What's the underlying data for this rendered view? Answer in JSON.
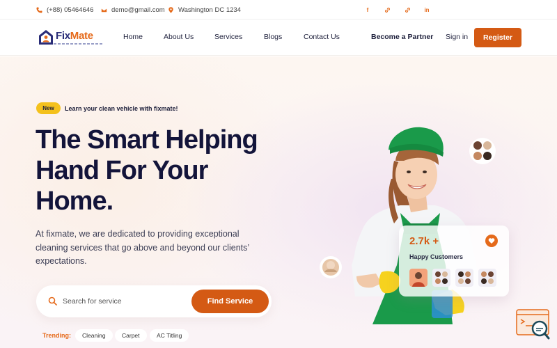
{
  "topbar": {
    "phone": "(+88) 05464646",
    "email": "demo@gmail.com",
    "address": "Washington DC 1234",
    "social": [
      "facebook-icon",
      "link-icon",
      "link-icon",
      "linkedin-icon"
    ],
    "linkedin_text": "in",
    "facebook_text": "f"
  },
  "nav": {
    "logo_fix": "Fix",
    "logo_mate": "Mate",
    "links": [
      "Home",
      "About Us",
      "Services",
      "Blogs",
      "Contact Us"
    ],
    "partner": "Become a Partner",
    "signin": "Sign in",
    "register": "Register"
  },
  "hero": {
    "badge": "New",
    "badge_text": "Learn your clean vehicle with fixmate!",
    "headline_lines": [
      "The Smart Helping",
      "Hand For Your",
      "Home."
    ],
    "lead": "At fixmate, we are dedicated to providing exceptional cleaning services that go above and beyond our clients’ expectations.",
    "search": {
      "placeholder": "Search for service",
      "value": ""
    },
    "find_button": "Find Service",
    "trending_label": "Trending:",
    "trending": [
      "Cleaning",
      "Carpet",
      "AC Titling"
    ]
  },
  "stats": {
    "count": "2.7k +",
    "label": "Happy Customers"
  },
  "colors": {
    "accent": "#d45a14",
    "brand_navy": "#2a2d78",
    "badge_yellow": "#f4c11c",
    "uniform_green": "#1a9a4a"
  }
}
